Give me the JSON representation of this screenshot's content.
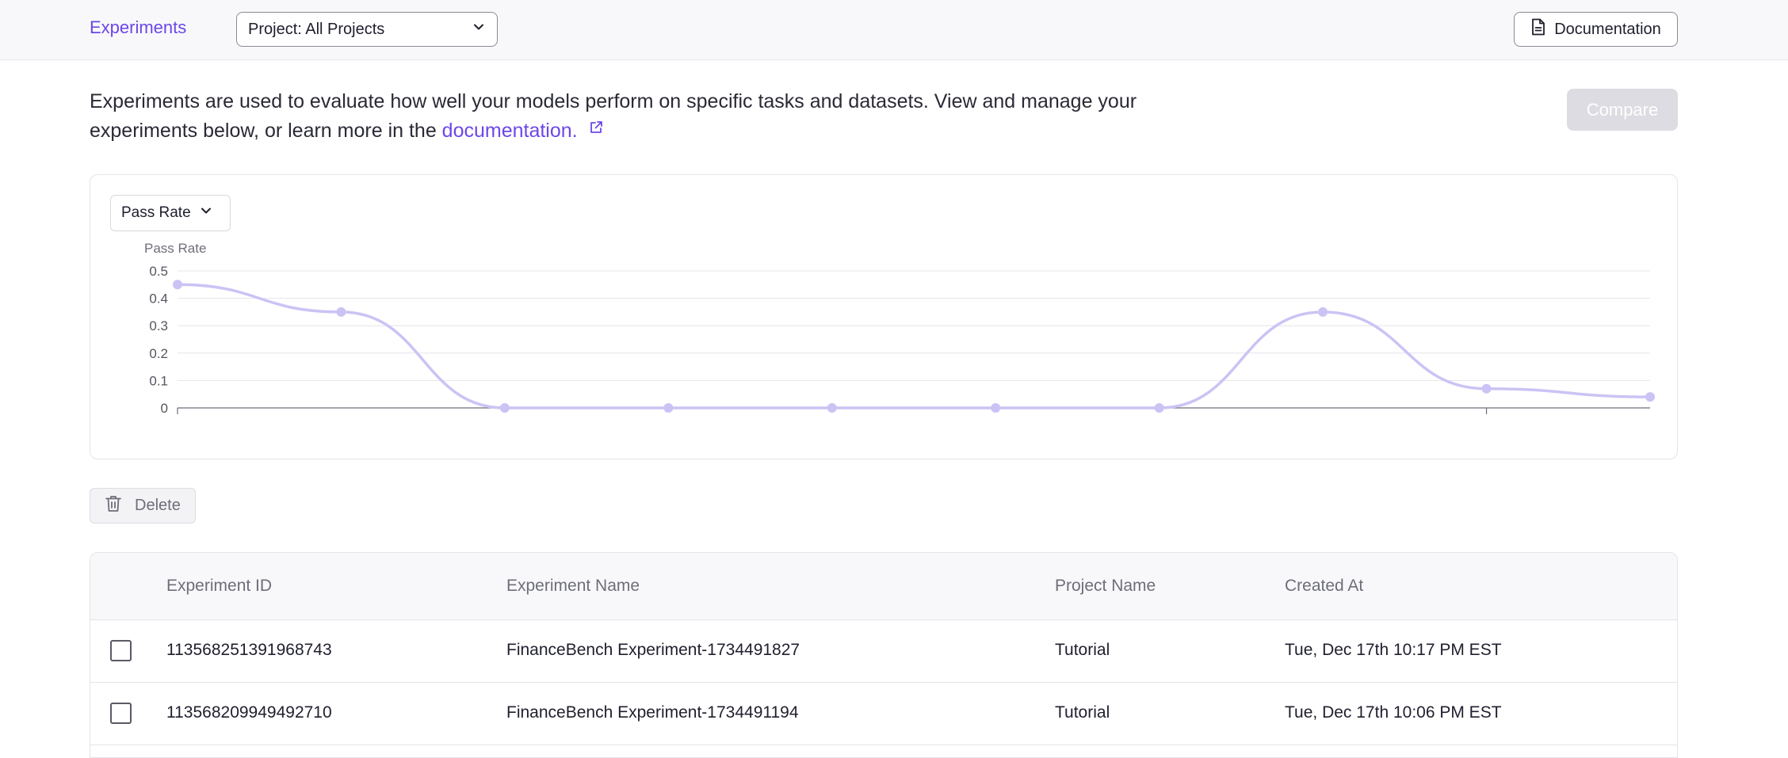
{
  "header": {
    "nav_experiments": "Experiments",
    "project_select_value": "Project: All Projects",
    "documentation_label": "Documentation"
  },
  "intro": {
    "text_before_link": "Experiments are used to evaluate how well your models perform on specific tasks and datasets. View and manage your experiments below, or learn more in the ",
    "link_text": "documentation.",
    "compare_label": "Compare"
  },
  "chart": {
    "metric_select_value": "Pass Rate",
    "y_axis_title": "Pass Rate"
  },
  "chart_data": {
    "type": "line",
    "title": "",
    "xlabel": "",
    "ylabel": "Pass Rate",
    "ylim": [
      0,
      0.5
    ],
    "y_ticks": [
      0,
      0.1,
      0.2,
      0.3,
      0.4,
      0.5
    ],
    "grid": true,
    "series": [
      {
        "values": [
          0.45,
          0.35,
          0,
          0,
          0,
          0,
          0,
          0.35,
          0.07,
          0.04
        ]
      }
    ],
    "colors": {
      "line": "#cbc3f4",
      "point": "#cbc3f4"
    }
  },
  "toolbar": {
    "delete_label": "Delete"
  },
  "table": {
    "columns": [
      "Experiment ID",
      "Experiment Name",
      "Project Name",
      "Created At"
    ],
    "rows": [
      {
        "id": "113568251391968743",
        "name": "FinanceBench Experiment-1734491827",
        "project": "Tutorial",
        "created": "Tue, Dec 17th 10:17 PM EST"
      },
      {
        "id": "113568209949492710",
        "name": "FinanceBench Experiment-1734491194",
        "project": "Tutorial",
        "created": "Tue, Dec 17th 10:06 PM EST"
      }
    ]
  },
  "colors": {
    "accent": "#6c47e8",
    "compare_disabled_bg": "#dcdce2"
  }
}
